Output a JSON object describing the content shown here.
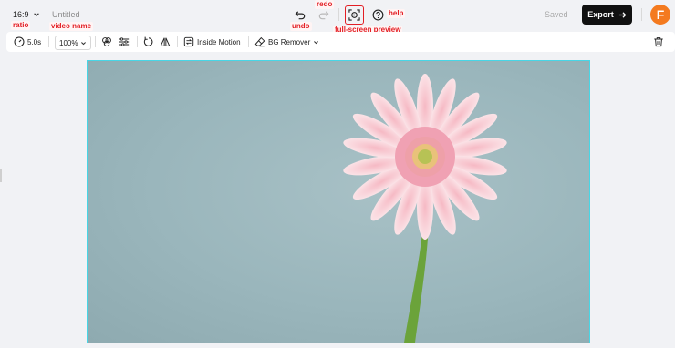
{
  "header": {
    "ratio_value": "16:9",
    "video_name": "Untitled",
    "saved_label": "Saved",
    "export_label": "Export",
    "logo_letter": "F"
  },
  "annotations": {
    "ratio": "ratio",
    "video_name": "video name",
    "undo": "undo",
    "redo": "redo",
    "full_screen_preview": "full-screen preview",
    "help": "help"
  },
  "toolbar": {
    "duration": "5.0s",
    "zoom": "100%",
    "inside_motion": "Inside Motion",
    "bg_remover": "BG Remover"
  },
  "icons": {
    "ratio": "chevron-down-icon",
    "undo": "undo-icon",
    "redo": "redo-icon",
    "preview": "full-screen-preview-icon",
    "help": "help-icon",
    "export": "arrow-right-icon",
    "duration": "clock-icon",
    "filters": "filters-icon",
    "adjust": "adjust-sliders-icon",
    "rotate": "rotate-icon",
    "flip": "flip-icon",
    "motion": "inside-motion-icon",
    "bg_remover": "eraser-icon",
    "delete": "trash-icon"
  },
  "canvas": {
    "image": "pink gerbera daisy on light blue background"
  },
  "colors": {
    "accent_annotation": "#e31e24",
    "selection_border": "#47d6e6",
    "export_bg": "#111111",
    "logo_bg": "#f47a1f",
    "canvas_bg": "#9ab6bc"
  }
}
